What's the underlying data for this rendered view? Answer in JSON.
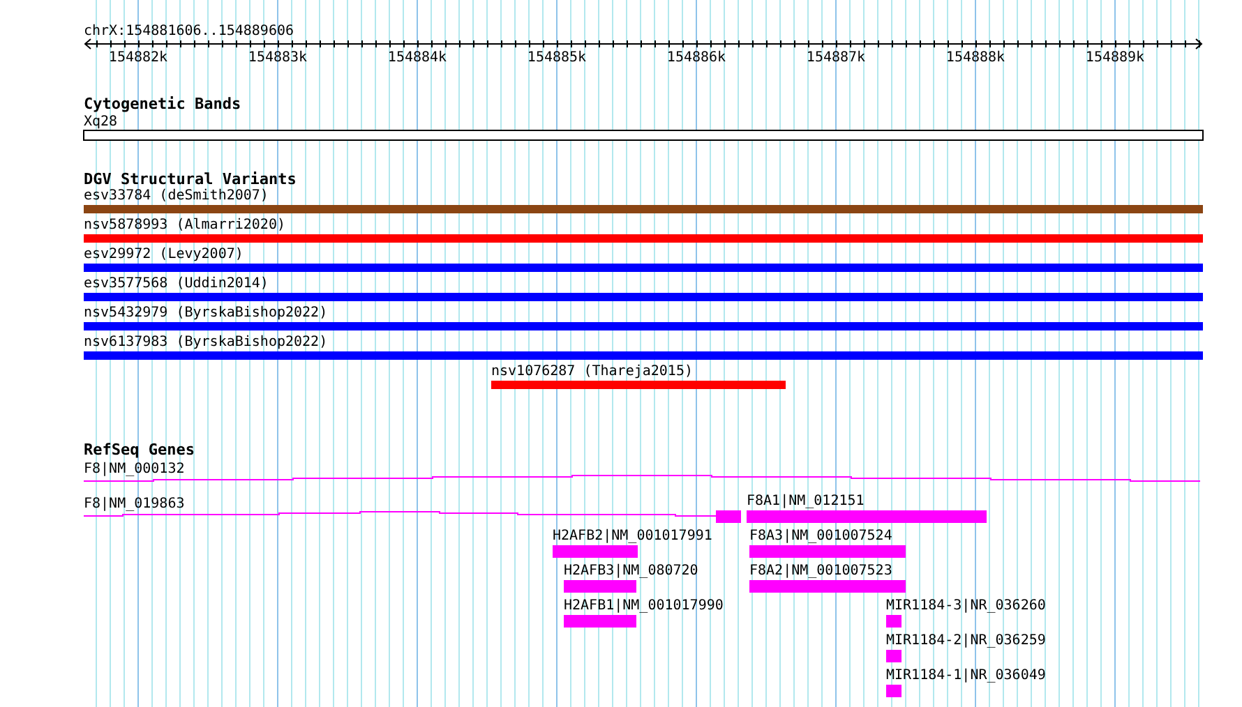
{
  "coordinates": "chrX:154881606..154889606",
  "ruler": {
    "ticks": [
      "154882k",
      "154883k",
      "154884k",
      "154885k",
      "154886k",
      "154887k",
      "154888k",
      "154889k"
    ]
  },
  "tracks": [
    {
      "kind": "cytoband",
      "title": "Cytogenetic Bands",
      "features": [
        {
          "label": "Xq28"
        }
      ]
    },
    {
      "kind": "variants",
      "title": "DGV Structural Variants",
      "features": [
        {
          "label": "esv33784 (deSmith2007)",
          "color": "#8b4513"
        },
        {
          "label": "nsv5878993 (Almarri2020)",
          "color": "#ff0000"
        },
        {
          "label": "esv29972 (Levy2007)",
          "color": "#0000ff"
        },
        {
          "label": "esv3577568 (Uddin2014)",
          "color": "#0000ff"
        },
        {
          "label": "nsv5432979 (ByrskaBishop2022)",
          "color": "#0000ff"
        },
        {
          "label": "nsv6137983 (ByrskaBishop2022)",
          "color": "#0000ff"
        },
        {
          "label": "nsv1076287 (Thareja2015)",
          "color": "#ff0000"
        }
      ]
    },
    {
      "kind": "genes",
      "title": "RefSeq Genes",
      "features": [
        {
          "label": "F8|NM_000132",
          "kind": "transcript"
        },
        {
          "label": "F8|NM_019863",
          "kind": "transcript"
        },
        {
          "label": "F8A1|NM_012151",
          "kind": "gene"
        },
        {
          "label": "H2AFB2|NM_001017991",
          "kind": "gene"
        },
        {
          "label": "F8A3|NM_001007524",
          "kind": "gene"
        },
        {
          "label": "H2AFB3|NM_080720",
          "kind": "gene"
        },
        {
          "label": "F8A2|NM_001007523",
          "kind": "gene"
        },
        {
          "label": "H2AFB1|NM_001017990",
          "kind": "gene"
        },
        {
          "label": "MIR1184-3|NR_036260",
          "kind": "gene"
        },
        {
          "label": "MIR1184-2|NR_036259",
          "kind": "gene"
        },
        {
          "label": "MIR1184-1|NR_036049",
          "kind": "gene"
        }
      ]
    }
  ]
}
